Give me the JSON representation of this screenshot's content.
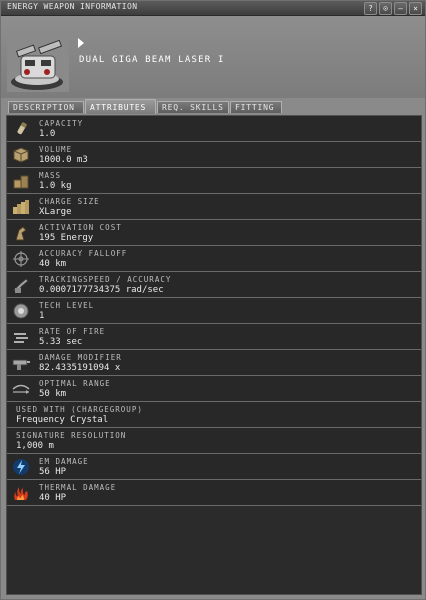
{
  "window": {
    "title": "ENERGY WEAPON INFORMATION",
    "buttons": [
      "?",
      "⊙",
      "–",
      "×"
    ]
  },
  "item": {
    "name": "DUAL GIGA BEAM LASER I"
  },
  "tabs": [
    {
      "label": "DESCRIPTION",
      "active": false
    },
    {
      "label": "ATTRIBUTES",
      "active": true
    },
    {
      "label": "REQ. SKILLS",
      "active": false
    },
    {
      "label": "FITTING",
      "active": false
    }
  ],
  "attributes": [
    {
      "label": "CAPACITY",
      "value": "1.0",
      "icon": "capacity-icon"
    },
    {
      "label": "VOLUME",
      "value": "1000.0 m3",
      "icon": "volume-icon"
    },
    {
      "label": "MASS",
      "value": "1.0 kg",
      "icon": "mass-icon"
    },
    {
      "label": "CHARGE SIZE",
      "value": "XLarge",
      "icon": "charge-size-icon"
    },
    {
      "label": "ACTIVATION COST",
      "value": "195 Energy",
      "icon": "activation-cost-icon"
    },
    {
      "label": "ACCURACY FALLOFF",
      "value": "40 km",
      "icon": "accuracy-falloff-icon"
    },
    {
      "label": "TRACKINGSPEED / ACCURACY",
      "value": "0.0007177734375 rad/sec",
      "icon": "tracking-speed-icon"
    },
    {
      "label": "TECH LEVEL",
      "value": "1",
      "icon": "tech-level-icon"
    },
    {
      "label": "RATE OF FIRE",
      "value": "5.33 sec",
      "icon": "rate-of-fire-icon"
    },
    {
      "label": "DAMAGE MODIFIER",
      "value": "82.4335191094 x",
      "icon": "damage-modifier-icon"
    },
    {
      "label": "OPTIMAL RANGE",
      "value": "50 km",
      "icon": "optimal-range-icon"
    },
    {
      "label": "USED WITH (CHARGEGROUP)",
      "value": "Frequency Crystal",
      "icon": ""
    },
    {
      "label": "SIGNATURE RESOLUTION",
      "value": "1,000 m",
      "icon": ""
    },
    {
      "label": "EM DAMAGE",
      "value": "56 HP",
      "icon": "em-damage-icon"
    },
    {
      "label": "THERMAL DAMAGE",
      "value": "40 HP",
      "icon": "thermal-damage-icon"
    }
  ]
}
